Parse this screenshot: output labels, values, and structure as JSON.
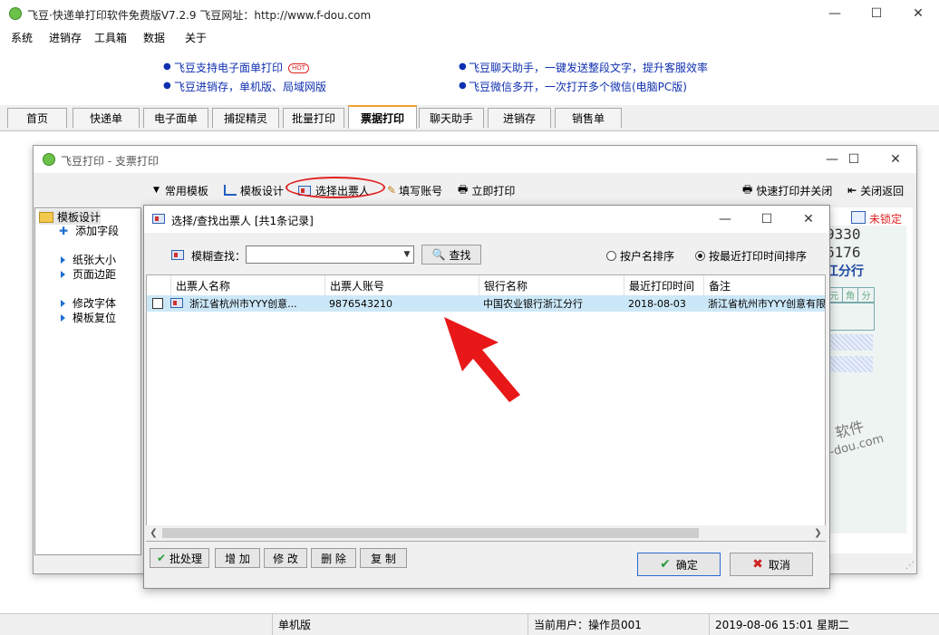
{
  "app": {
    "title": "飞豆·快递单打印软件免费版V7.2.9   飞豆网址：http://www.f-dou.com",
    "menu": [
      "系统",
      "进销存",
      "工具箱",
      "数据",
      "关于"
    ],
    "ads": [
      {
        "text": "飞豆支持电子面单打印",
        "badge": "HOT"
      },
      {
        "text": "飞豆进销存，单机版、局域网版"
      },
      {
        "text": "飞豆聊天助手，一键发送整段文字，提升客服效率"
      },
      {
        "text": "飞豆微信多开，一次打开多个微信(电脑PC版)"
      }
    ],
    "tabs": [
      "首页",
      "快递单",
      "电子面单",
      "捕捉精灵",
      "批量打印",
      "票据打印",
      "聊天助手",
      "进销存",
      "销售单"
    ],
    "active_tab": "票据打印",
    "status": {
      "edition": "单机版",
      "user": "当前用户：操作员001",
      "datetime": "2019-08-06 15:01 星期二"
    }
  },
  "check_dialog": {
    "title": "飞豆打印 - 支票打印",
    "toolbar": [
      "常用模板",
      "模板设计",
      "选择出票人",
      "填写账号",
      "立即打印"
    ],
    "toolbar_right": [
      "快速打印并关闭",
      "关闭返回"
    ],
    "tree": {
      "root": "模板设计",
      "items": [
        "添加字段",
        "纸张大小",
        "页面边距",
        "修改字体",
        "模板复位"
      ]
    },
    "preview": {
      "lock_label": "未锁定",
      "num1": "9330",
      "num2": "6176",
      "branch": "江分行",
      "units": [
        "元",
        "角",
        "分"
      ],
      "watermark1": "软件",
      "watermark2": "f-dou.com"
    }
  },
  "drawer_dialog": {
    "title": "选择/查找出票人   [共1条记录]",
    "search_label": "模糊查找：",
    "search_value": "",
    "search_button": "查找",
    "sort_options": [
      {
        "label": "按户名排序",
        "selected": false
      },
      {
        "label": "按最近打印时间排序",
        "selected": true
      }
    ],
    "columns": [
      "出票人名称",
      "出票人账号",
      "银行名称",
      "最近打印时间",
      "备注"
    ],
    "rows": [
      {
        "name": "浙江省杭州市YYY创意...",
        "account": "9876543210",
        "bank": "中国农业银行浙江分行",
        "last_print": "2018-08-03",
        "note": "浙江省杭州市YYY创意有限"
      }
    ],
    "buttons": [
      "批处理",
      "增 加",
      "修 改",
      "删 除",
      "复 制"
    ],
    "ok": "确定",
    "cancel": "取消"
  },
  "colors": {
    "accent_red": "#e02020",
    "link_blue": "#1030b0",
    "row_select": "#cce8f8",
    "tab_active_top": "#f0a030"
  }
}
